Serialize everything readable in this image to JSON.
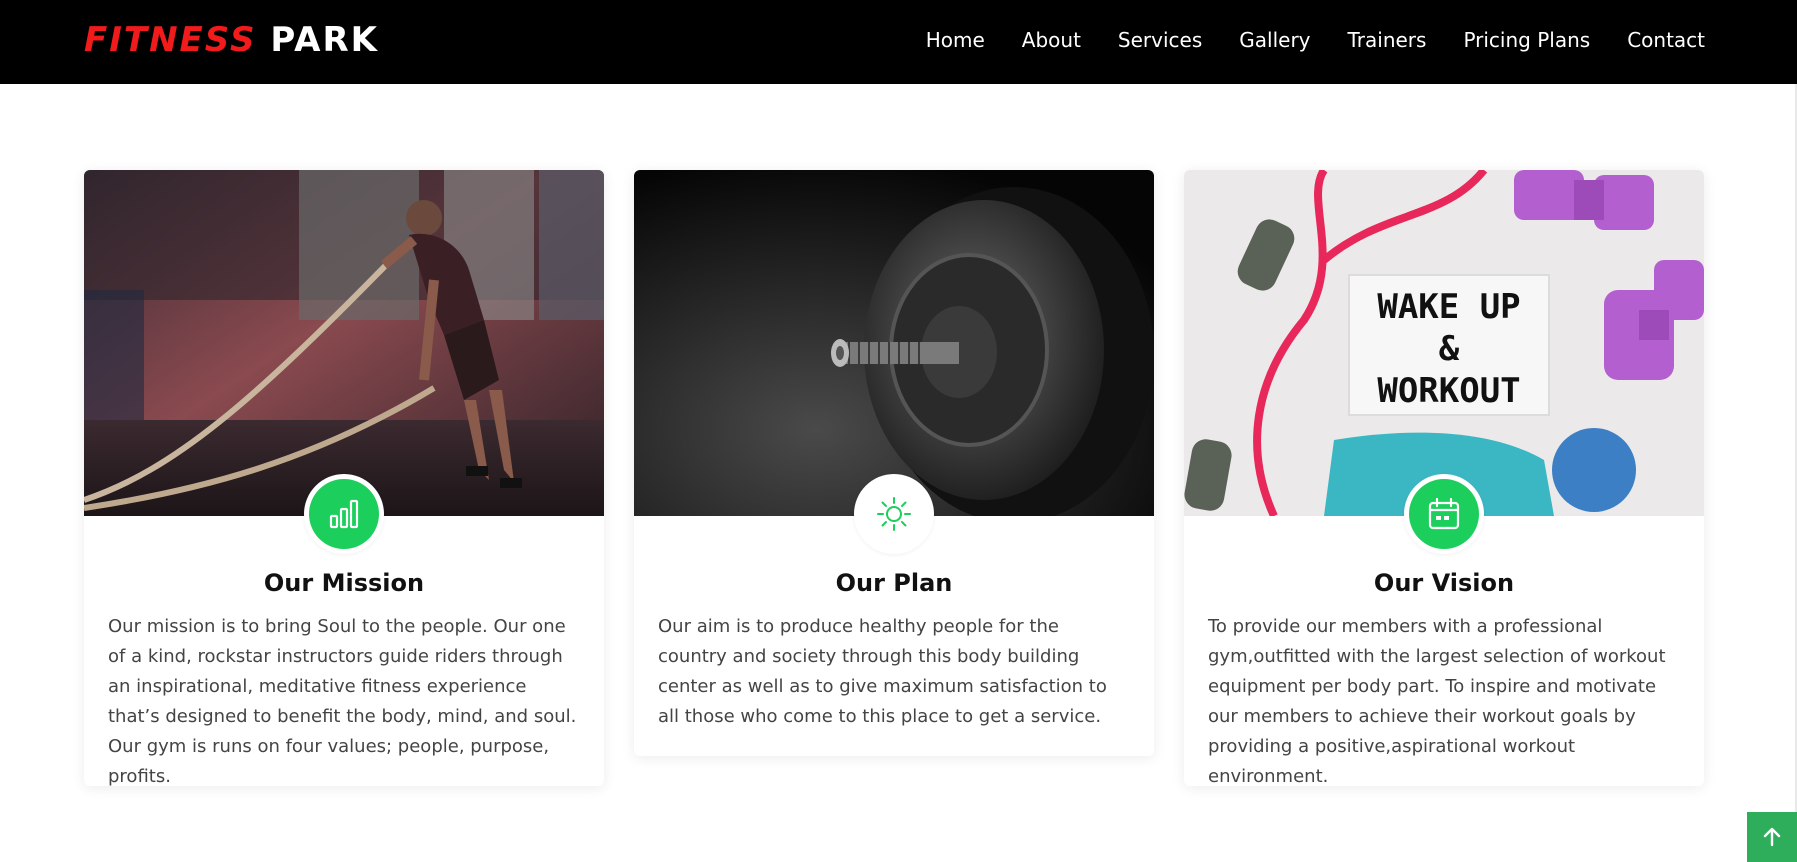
{
  "header": {
    "logo_part1": "FITNESS",
    "logo_part2": "PARK",
    "nav": [
      {
        "label": "Home"
      },
      {
        "label": "About"
      },
      {
        "label": "Services"
      },
      {
        "label": "Gallery"
      },
      {
        "label": "Trainers"
      },
      {
        "label": "Pricing Plans"
      },
      {
        "label": "Contact"
      }
    ]
  },
  "cards": [
    {
      "title": "Our Mission",
      "icon": "bar-chart-icon",
      "text": "Our mission is to bring Soul to the people. Our one of a kind, rockstar instructors guide riders through an inspirational, meditative fitness experience that’s designed to benefit the body, mind, and soul. Our gym is runs on four values; people, purpose, profits."
    },
    {
      "title": "Our Plan",
      "icon": "sun-icon",
      "text": "Our aim is to produce healthy people for the country and society through this body building center as well as to give maximum satisfaction to all those who come to this place to get a service."
    },
    {
      "title": "Our Vision",
      "icon": "calendar-icon",
      "text": "To provide our members with a professional gym,outfitted with the largest selection of workout equipment per body part. To inspire and motivate our members to achieve their workout goals by providing a positive,aspirational workout environment.",
      "image_text": [
        "WAKE UP",
        "&",
        "WORKOUT"
      ]
    }
  ],
  "colors": {
    "accent_green": "#1ccf5c",
    "logo_red": "#f11b1b",
    "header_bg": "#000000",
    "to_top_bg": "#2eae5b"
  },
  "to_top": {
    "icon": "arrow-up-icon"
  }
}
